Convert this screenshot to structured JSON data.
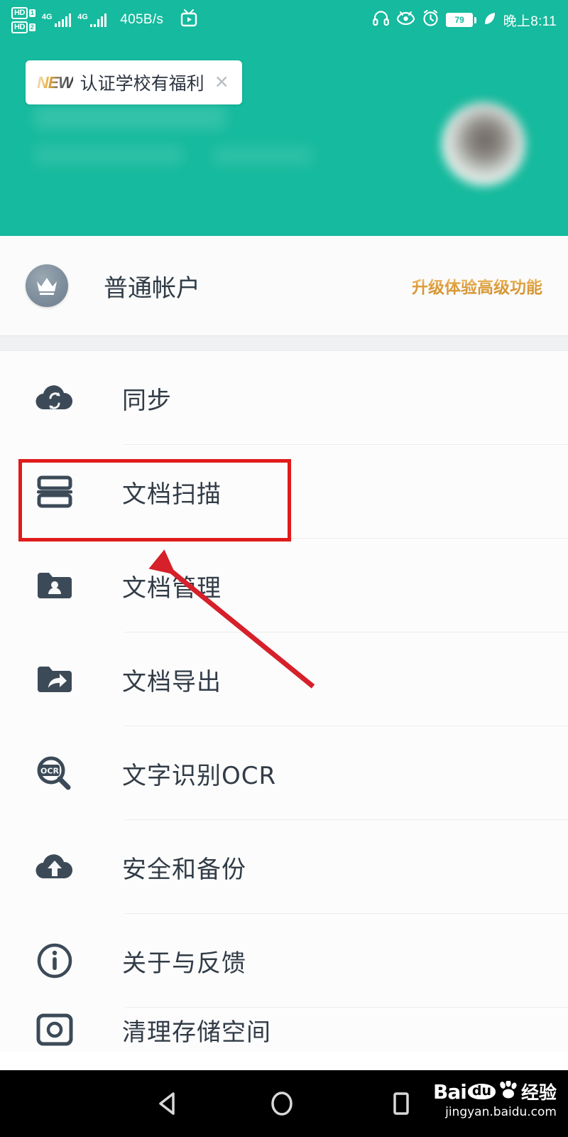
{
  "statusbar": {
    "hd_labels": [
      "HD",
      "HD"
    ],
    "hd_indices": [
      "1",
      "2"
    ],
    "network_type_1": "4G",
    "network_type_2": "4G",
    "net_speed": "405B/s",
    "tv_icon": "tv-icon",
    "headphone_icon": "headphone-icon",
    "eyecare_icon": "eye-care-icon",
    "alarm_icon": "alarm-clock-icon",
    "battery_percent": "79",
    "leaf_icon": "power-saving-leaf-icon",
    "clock": "晚上8:11"
  },
  "header": {
    "promo": {
      "new_badge": "NEW",
      "text": "认证学校有福利",
      "close": "✕"
    },
    "avatar": "user-avatar"
  },
  "account": {
    "crown_icon": "crown-icon",
    "name": "普通帐户",
    "upgrade_label": "升级体验高级功能"
  },
  "menu": {
    "items": [
      {
        "icon": "cloud-sync-icon",
        "label": "同步"
      },
      {
        "icon": "document-scan-icon",
        "label": "文档扫描"
      },
      {
        "icon": "folder-user-icon",
        "label": "文档管理"
      },
      {
        "icon": "folder-share-icon",
        "label": "文档导出"
      },
      {
        "icon": "ocr-search-icon",
        "label": "文字识别OCR"
      },
      {
        "icon": "cloud-upload-icon",
        "label": "安全和备份"
      },
      {
        "icon": "info-circle-icon",
        "label": "关于与反馈"
      },
      {
        "icon": "storage-clean-icon",
        "label": "清理存储空间"
      }
    ]
  },
  "annotations": {
    "highlight_color": "#e01b1b",
    "highlight_target": "文档扫描",
    "arrow_color": "#d6202a"
  },
  "navbar": {
    "back_icon": "back-triangle-icon",
    "home_icon": "home-circle-icon",
    "recents_icon": "recents-square-icon",
    "watermark_bai": "Bai",
    "watermark_du": "du",
    "watermark_cn": "经验",
    "watermark_url": "jingyan.baidu.com"
  },
  "colors": {
    "brand_teal": "#16ba9e",
    "upgrade_gold": "#e0a03c",
    "icon_slate": "#3c4a58",
    "annotation_red": "#e01b1b"
  }
}
